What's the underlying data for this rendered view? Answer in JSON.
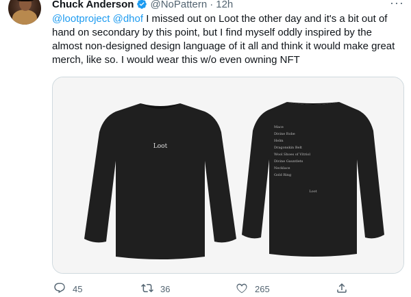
{
  "tweet": {
    "author_name": "Chuck Anderson",
    "handle": "@NoPattern",
    "separator": "·",
    "time": "12h",
    "more_label": "···",
    "text_mention_1": "@lootproject",
    "text_mention_2": "@dhof",
    "text_body": " I missed out on Loot the other day and it's a bit out of hand on secondary by this point, but I find myself oddly inspired by the almost non-designed design language of it all and think it would make great merch, like so. I would wear this w/o even owning NFT",
    "media": {
      "front_text": "Loot",
      "back_items": [
        "Mace",
        "Divine Robe",
        "Helm",
        "Dragonskin Belt",
        "Wool Shoes of Vitriol",
        "Divine Gauntlets",
        "Necklace",
        "Gold Ring"
      ],
      "back_footer": "Loot"
    },
    "actions": {
      "reply_count": "45",
      "retweet_count": "36",
      "like_count": "265"
    }
  },
  "icons": {
    "verified": "verified-badge-icon",
    "reply": "reply-icon",
    "retweet": "retweet-icon",
    "like": "heart-icon",
    "share": "share-icon",
    "more": "more-icon"
  },
  "colors": {
    "accent": "#1d9bf0",
    "muted": "#536471",
    "text": "#0f1419",
    "shirt": "#1f1f1f",
    "media_bg": "#f5f5f5"
  }
}
